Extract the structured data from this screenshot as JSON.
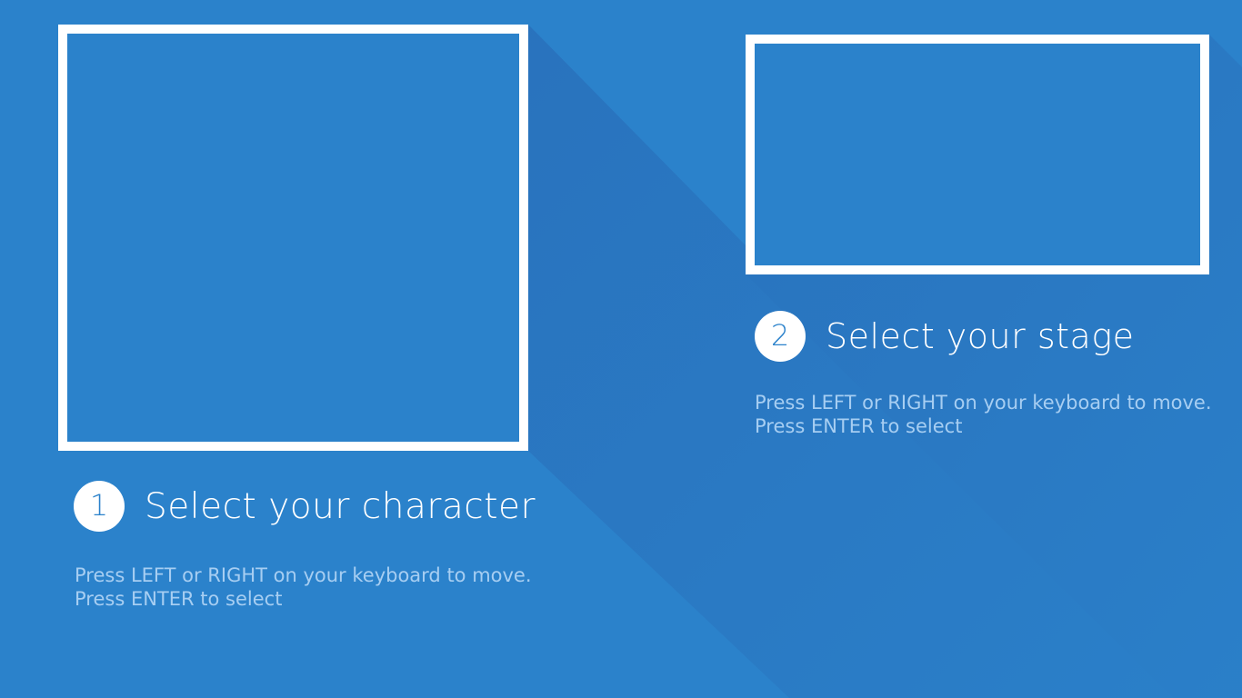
{
  "colors": {
    "background": "#2b82cb",
    "shadow": "#2a6db8",
    "frame_border": "#ffffff",
    "instruction_text": "#a7cef2"
  },
  "character_select": {
    "step_number": "1",
    "title": "Select your character",
    "instructions_line1": "Press LEFT or RIGHT on your keyboard to move.",
    "instructions_line2": "Press ENTER to select"
  },
  "stage_select": {
    "step_number": "2",
    "title": "Select your stage",
    "instructions_line1": "Press LEFT or RIGHT on your keyboard to move.",
    "instructions_line2": "Press ENTER to select"
  }
}
